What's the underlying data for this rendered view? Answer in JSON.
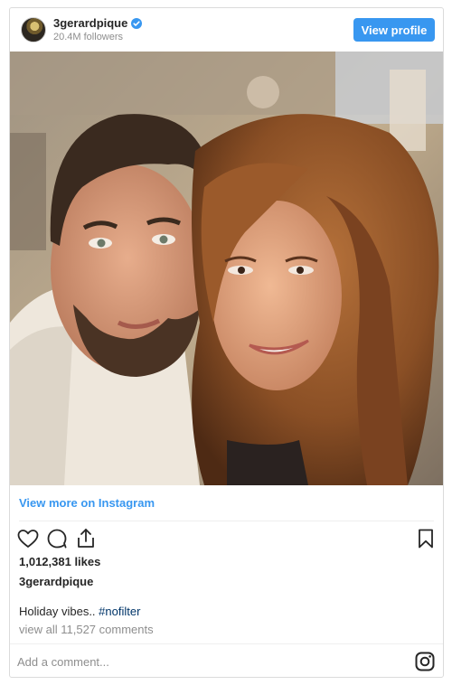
{
  "post": {
    "username": "3gerardpique",
    "followers": "20.4M followers",
    "view_profile_label": "View profile",
    "view_more_label": "View more on Instagram",
    "likes": "1,012,381 likes",
    "caption_username": "3gerardpique",
    "caption_text": "Holiday vibes.. ",
    "caption_hashtag": "#nofilter",
    "comments_link": "view all 11,527 comments",
    "comment_placeholder": "Add a comment..."
  },
  "icons": {
    "verified": "verified-badge-icon",
    "like": "heart-icon",
    "comment": "comment-bubble-icon",
    "share": "share-icon",
    "save": "bookmark-icon",
    "brand": "instagram-icon"
  },
  "colors": {
    "accent": "#3897f0",
    "hashtag": "#003569",
    "muted": "#8e8e8e"
  }
}
